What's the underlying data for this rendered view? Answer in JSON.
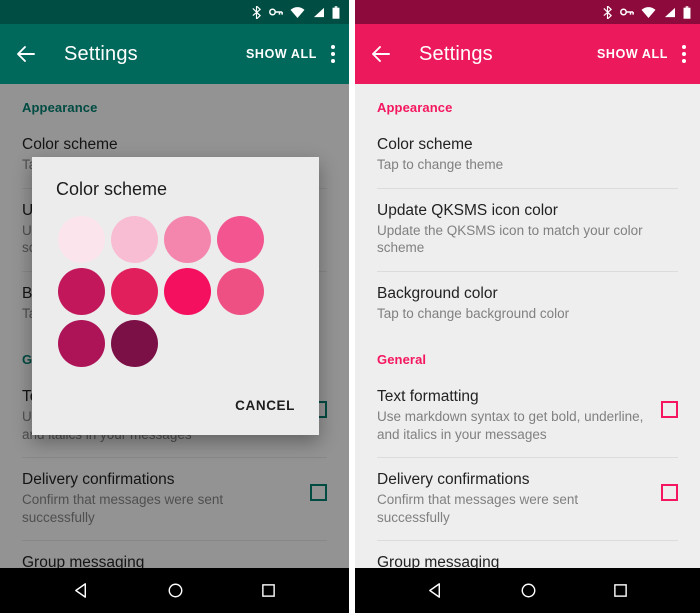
{
  "colors": {
    "left_status_bar": "#004e43",
    "left_app_bar": "#00695c",
    "left_accent": "#00796b",
    "right_status_bar": "#8d0b3c",
    "right_app_bar": "#ec1a5c",
    "right_accent": "#f4165e",
    "list_background": "#eeeeee",
    "dialog_background": "#ececed",
    "nav_bar": "#000000"
  },
  "status_bar": {
    "icons": [
      "bluetooth-icon",
      "vpn-key-icon",
      "wifi-icon",
      "cell-signal-icon",
      "battery-icon"
    ]
  },
  "app_bar": {
    "back_label": "back-arrow-icon",
    "title": "Settings",
    "show_all_label": "SHOW ALL",
    "overflow_label": "overflow-menu-icon"
  },
  "settings": {
    "sections": [
      {
        "heading": "Appearance",
        "rows": [
          {
            "title": "Color scheme",
            "subtitle": "Tap to change theme",
            "has_checkbox": false
          },
          {
            "title": "Update QKSMS icon color",
            "subtitle": "Update the QKSMS icon to match your color scheme",
            "has_checkbox": false
          },
          {
            "title": "Background color",
            "subtitle": "Tap to change background color",
            "has_checkbox": false
          }
        ]
      },
      {
        "heading": "General",
        "rows": [
          {
            "title": "Text formatting",
            "subtitle": "Use markdown syntax to get bold, underline, and italics in your messages",
            "has_checkbox": true,
            "checked": false
          },
          {
            "title": "Delivery confirmations",
            "subtitle": "Confirm that messages were sent successfully",
            "has_checkbox": true,
            "checked": false
          },
          {
            "title": "Group messaging",
            "subtitle": "",
            "has_checkbox": false
          }
        ]
      }
    ]
  },
  "dialog": {
    "title": "Color scheme",
    "cancel_label": "CANCEL",
    "swatches": [
      {
        "name": "pink-50",
        "hex": "#fce4ec"
      },
      {
        "name": "pink-100",
        "hex": "#f9bdd3"
      },
      {
        "name": "pink-200",
        "hex": "#f486ae"
      },
      {
        "name": "pink-300",
        "hex": "#f2558f"
      },
      {
        "name": "pink-700",
        "hex": "#c2185b"
      },
      {
        "name": "pink-600",
        "hex": "#e01f5c"
      },
      {
        "name": "pink-500",
        "hex": "#f50f5f"
      },
      {
        "name": "pink-400",
        "hex": "#ef5083"
      },
      {
        "name": "pink-800",
        "hex": "#ad1457"
      },
      {
        "name": "pink-900",
        "hex": "#7b1046"
      }
    ]
  },
  "nav_bar": {
    "items": [
      "back-triangle-icon",
      "home-circle-icon",
      "recents-square-icon"
    ]
  }
}
